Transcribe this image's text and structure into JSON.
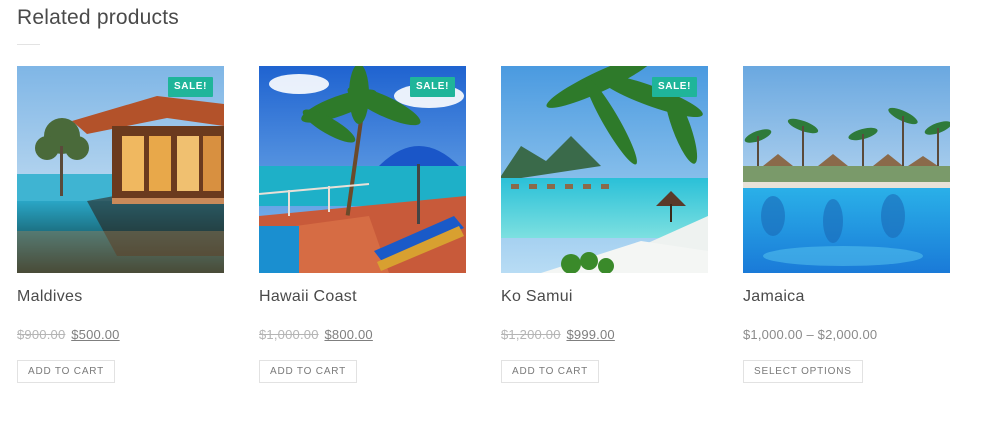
{
  "section": {
    "title": "Related products"
  },
  "products": [
    {
      "name": "Maldives",
      "badge": "SALE!",
      "old_price": "$900.00",
      "price": "$500.00",
      "button": "ADD TO CART",
      "image": "resort-villa-infinity-pool"
    },
    {
      "name": "Hawaii Coast",
      "badge": "SALE!",
      "old_price": "$1,000.00",
      "price": "$800.00",
      "button": "ADD TO CART",
      "image": "palm-terrace-beach-umbrella"
    },
    {
      "name": "Ko Samui",
      "badge": "SALE!",
      "old_price": "$1,200.00",
      "price": "$999.00",
      "button": "ADD TO CART",
      "image": "turquoise-lagoon-palms"
    },
    {
      "name": "Jamaica",
      "price_range": "$1,000.00 – $2,000.00",
      "button": "SELECT OPTIONS",
      "image": "resort-pool-palms"
    }
  ],
  "colors": {
    "badge": "#1fb59a",
    "title": "#4a4a4a",
    "muted": "#8a8a8a"
  }
}
